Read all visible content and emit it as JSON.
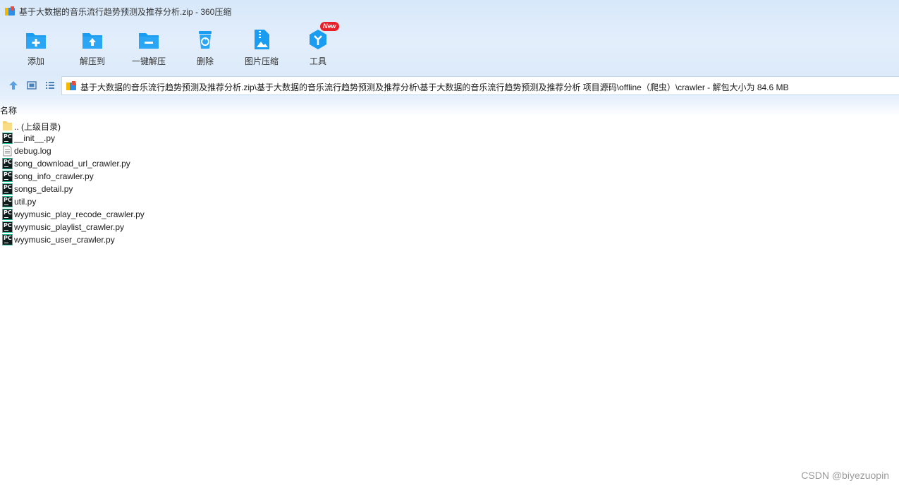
{
  "window": {
    "title": "基于大数据的音乐流行趋势预测及推荐分析.zip - 360压缩"
  },
  "toolbar": {
    "items": [
      {
        "label": "添加",
        "icon": "add-icon"
      },
      {
        "label": "解压到",
        "icon": "extract-to-icon"
      },
      {
        "label": "一键解压",
        "icon": "one-click-extract-icon"
      },
      {
        "label": "删除",
        "icon": "delete-icon"
      },
      {
        "label": "图片压缩",
        "icon": "image-compress-icon"
      },
      {
        "label": "工具",
        "icon": "tools-icon",
        "badge": "New"
      }
    ]
  },
  "address": {
    "path": "基于大数据的音乐流行趋势预测及推荐分析.zip\\基于大数据的音乐流行趋势预测及推荐分析\\基于大数据的音乐流行趋势预测及推荐分析 项目源码\\offline（爬虫）\\crawler - 解包大小为 84.6 MB"
  },
  "list": {
    "column_name": "名称",
    "files": [
      {
        "name": ".. (上级目录)",
        "type": "folder"
      },
      {
        "name": "__init__.py",
        "type": "pycharm"
      },
      {
        "name": "debug.log",
        "type": "text"
      },
      {
        "name": "song_download_url_crawler.py",
        "type": "pycharm"
      },
      {
        "name": "song_info_crawler.py",
        "type": "pycharm"
      },
      {
        "name": "songs_detail.py",
        "type": "pycharm"
      },
      {
        "name": "util.py",
        "type": "pycharm"
      },
      {
        "name": "wyymusic_play_recode_crawler.py",
        "type": "pycharm"
      },
      {
        "name": "wyymusic_playlist_crawler.py",
        "type": "pycharm"
      },
      {
        "name": "wyymusic_user_crawler.py",
        "type": "pycharm"
      }
    ]
  },
  "watermark": "CSDN @biyezuopin",
  "colors": {
    "accent": "#1a9cf0",
    "badge": "#e8202a",
    "pycharm_border": "#20c29a"
  }
}
